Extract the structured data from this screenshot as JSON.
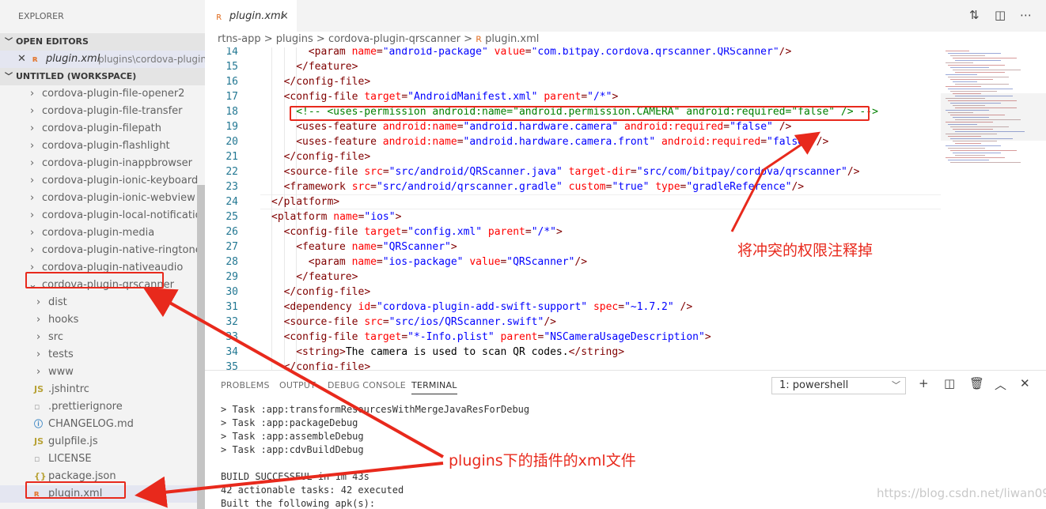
{
  "sidebar": {
    "title": "EXPLORER",
    "open_editors": "OPEN EDITORS",
    "open_file_name": "plugin.xml",
    "open_file_path": "plugins\\cordova-plugin-...",
    "workspace": "UNTITLED (WORKSPACE)",
    "folders": [
      "cordova-plugin-file-opener2",
      "cordova-plugin-file-transfer",
      "cordova-plugin-filepath",
      "cordova-plugin-flashlight",
      "cordova-plugin-inappbrowser",
      "cordova-plugin-ionic-keyboard",
      "cordova-plugin-ionic-webview",
      "cordova-plugin-local-notification",
      "cordova-plugin-media",
      "cordova-plugin-native-ringtones",
      "cordova-plugin-nativeaudio"
    ],
    "expanded_folder": "cordova-plugin-qrscanner",
    "subfolders": [
      "dist",
      "hooks",
      "src",
      "tests",
      "www"
    ],
    "files": [
      {
        "icon": "JS",
        "name": ".jshintrc"
      },
      {
        "icon": "",
        "name": ".prettierignore"
      },
      {
        "icon": "ⓘ",
        "name": "CHANGELOG.md"
      },
      {
        "icon": "JS",
        "name": "gulpfile.js"
      },
      {
        "icon": "",
        "name": "LICENSE"
      },
      {
        "icon": "{}",
        "name": "package.json"
      },
      {
        "icon": "",
        "name": "plugin.xml"
      }
    ]
  },
  "tab": {
    "label": "plugin.xml",
    "close": "×"
  },
  "breadcrumb": {
    "items": [
      "rtns-app",
      "plugins",
      "cordova-plugin-qrscanner",
      "plugin.xml"
    ],
    "sep": ">"
  },
  "code": {
    "lines": [
      {
        "n": "14",
        "indent": 6,
        "parts": [
          [
            "tg",
            "<param "
          ],
          [
            "at",
            "name"
          ],
          [
            "tg",
            "="
          ],
          [
            "vl",
            "\"android-package\""
          ],
          [
            "tg",
            " "
          ],
          [
            "at",
            "value"
          ],
          [
            "tg",
            "="
          ],
          [
            "vl",
            "\"com.bitpay.cordova.qrscanner.QRScanner\""
          ],
          [
            "tg",
            "/>"
          ]
        ]
      },
      {
        "n": "15",
        "indent": 4,
        "parts": [
          [
            "tg",
            "</feature>"
          ]
        ]
      },
      {
        "n": "16",
        "indent": 2,
        "parts": [
          [
            "tg",
            "</config-file>"
          ]
        ]
      },
      {
        "n": "17",
        "indent": 2,
        "parts": [
          [
            "tg",
            "<config-file "
          ],
          [
            "at",
            "target"
          ],
          [
            "tg",
            "="
          ],
          [
            "vl",
            "\"AndroidManifest.xml\""
          ],
          [
            "tg",
            " "
          ],
          [
            "at",
            "parent"
          ],
          [
            "tg",
            "="
          ],
          [
            "vl",
            "\"/*\""
          ],
          [
            "tg",
            ">"
          ]
        ]
      },
      {
        "n": "18",
        "indent": 4,
        "parts": [
          [
            "cm",
            "<!-- <uses-permission android:name=\"android.permission.CAMERA\" android:required=\"false\" /> -->"
          ]
        ]
      },
      {
        "n": "19",
        "indent": 4,
        "parts": [
          [
            "tg",
            "<uses-feature "
          ],
          [
            "at",
            "android:name"
          ],
          [
            "tg",
            "="
          ],
          [
            "vl",
            "\"android.hardware.camera\""
          ],
          [
            "tg",
            " "
          ],
          [
            "at",
            "android:required"
          ],
          [
            "tg",
            "="
          ],
          [
            "vl",
            "\"false\""
          ],
          [
            "tg",
            " />"
          ]
        ]
      },
      {
        "n": "20",
        "indent": 4,
        "parts": [
          [
            "tg",
            "<uses-feature "
          ],
          [
            "at",
            "android:name"
          ],
          [
            "tg",
            "="
          ],
          [
            "vl",
            "\"android.hardware.camera.front\""
          ],
          [
            "tg",
            " "
          ],
          [
            "at",
            "android:required"
          ],
          [
            "tg",
            "="
          ],
          [
            "vl",
            "\"false\""
          ],
          [
            "tg",
            " />"
          ]
        ]
      },
      {
        "n": "21",
        "indent": 2,
        "parts": [
          [
            "tg",
            "</config-file>"
          ]
        ]
      },
      {
        "n": "22",
        "indent": 2,
        "parts": [
          [
            "tg",
            "<source-file "
          ],
          [
            "at",
            "src"
          ],
          [
            "tg",
            "="
          ],
          [
            "vl",
            "\"src/android/QRScanner.java\""
          ],
          [
            "tg",
            " "
          ],
          [
            "at",
            "target-dir"
          ],
          [
            "tg",
            "="
          ],
          [
            "vl",
            "\"src/com/bitpay/cordova/qrscanner\""
          ],
          [
            "tg",
            "/>"
          ]
        ]
      },
      {
        "n": "23",
        "indent": 2,
        "parts": [
          [
            "tg",
            "<framework "
          ],
          [
            "at",
            "src"
          ],
          [
            "tg",
            "="
          ],
          [
            "vl",
            "\"src/android/qrscanner.gradle\""
          ],
          [
            "tg",
            " "
          ],
          [
            "at",
            "custom"
          ],
          [
            "tg",
            "="
          ],
          [
            "vl",
            "\"true\""
          ],
          [
            "tg",
            " "
          ],
          [
            "at",
            "type"
          ],
          [
            "tg",
            "="
          ],
          [
            "vl",
            "\"gradleReference\""
          ],
          [
            "tg",
            "/>"
          ]
        ]
      },
      {
        "n": "24",
        "indent": 0,
        "parts": [
          [
            "tg",
            "</platform>"
          ]
        ]
      },
      {
        "n": "25",
        "indent": 0,
        "parts": [
          [
            "tg",
            "<platform "
          ],
          [
            "at",
            "name"
          ],
          [
            "tg",
            "="
          ],
          [
            "vl",
            "\"ios\""
          ],
          [
            "tg",
            ">"
          ]
        ]
      },
      {
        "n": "26",
        "indent": 2,
        "parts": [
          [
            "tg",
            "<config-file "
          ],
          [
            "at",
            "target"
          ],
          [
            "tg",
            "="
          ],
          [
            "vl",
            "\"config.xml\""
          ],
          [
            "tg",
            " "
          ],
          [
            "at",
            "parent"
          ],
          [
            "tg",
            "="
          ],
          [
            "vl",
            "\"/*\""
          ],
          [
            "tg",
            ">"
          ]
        ]
      },
      {
        "n": "27",
        "indent": 4,
        "parts": [
          [
            "tg",
            "<feature "
          ],
          [
            "at",
            "name"
          ],
          [
            "tg",
            "="
          ],
          [
            "vl",
            "\"QRScanner\""
          ],
          [
            "tg",
            ">"
          ]
        ]
      },
      {
        "n": "28",
        "indent": 6,
        "parts": [
          [
            "tg",
            "<param "
          ],
          [
            "at",
            "name"
          ],
          [
            "tg",
            "="
          ],
          [
            "vl",
            "\"ios-package\""
          ],
          [
            "tg",
            " "
          ],
          [
            "at",
            "value"
          ],
          [
            "tg",
            "="
          ],
          [
            "vl",
            "\"QRScanner\""
          ],
          [
            "tg",
            "/>"
          ]
        ]
      },
      {
        "n": "29",
        "indent": 4,
        "parts": [
          [
            "tg",
            "</feature>"
          ]
        ]
      },
      {
        "n": "30",
        "indent": 2,
        "parts": [
          [
            "tg",
            "</config-file>"
          ]
        ]
      },
      {
        "n": "31",
        "indent": 2,
        "parts": [
          [
            "tg",
            "<dependency "
          ],
          [
            "at",
            "id"
          ],
          [
            "tg",
            "="
          ],
          [
            "vl",
            "\"cordova-plugin-add-swift-support\""
          ],
          [
            "tg",
            " "
          ],
          [
            "at",
            "spec"
          ],
          [
            "tg",
            "="
          ],
          [
            "vl",
            "\"~1.7.2\""
          ],
          [
            "tg",
            " />"
          ]
        ]
      },
      {
        "n": "32",
        "indent": 2,
        "parts": [
          [
            "tg",
            "<source-file "
          ],
          [
            "at",
            "src"
          ],
          [
            "tg",
            "="
          ],
          [
            "vl",
            "\"src/ios/QRScanner.swift\""
          ],
          [
            "tg",
            "/>"
          ]
        ]
      },
      {
        "n": "33",
        "indent": 2,
        "parts": [
          [
            "tg",
            "<config-file "
          ],
          [
            "at",
            "target"
          ],
          [
            "tg",
            "="
          ],
          [
            "vl",
            "\"*-Info.plist\""
          ],
          [
            "tg",
            " "
          ],
          [
            "at",
            "parent"
          ],
          [
            "tg",
            "="
          ],
          [
            "vl",
            "\"NSCameraUsageDescription\""
          ],
          [
            "tg",
            ">"
          ]
        ]
      },
      {
        "n": "34",
        "indent": 4,
        "parts": [
          [
            "tg",
            "<string>"
          ],
          [
            "tx",
            "The camera is used to scan QR codes."
          ],
          [
            "tg",
            "</string>"
          ]
        ]
      },
      {
        "n": "35",
        "indent": 2,
        "parts": [
          [
            "tg",
            "</config-file>"
          ]
        ]
      }
    ]
  },
  "panel": {
    "tabs": [
      "PROBLEMS",
      "OUTPUT",
      "DEBUG CONSOLE",
      "TERMINAL"
    ],
    "active_tab": "TERMINAL",
    "terminal_select": "1: powershell",
    "terminal_lines": [
      "> Task :app:transformResourcesWithMergeJavaResForDebug",
      "> Task :app:packageDebug",
      "> Task :app:assembleDebug",
      "> Task :app:cdvBuildDebug",
      "",
      "BUILD SUCCESSFUL in 1m 43s",
      "42 actionable tasks: 42 executed",
      "Built the following apk(s):"
    ]
  },
  "annotations": {
    "comment_note": "将冲突的权限注释掉",
    "plugin_note": "plugins下的插件的xml文件",
    "accent_color": "#e8291c"
  },
  "watermark": "https://blog.csdn.net/liwan09"
}
